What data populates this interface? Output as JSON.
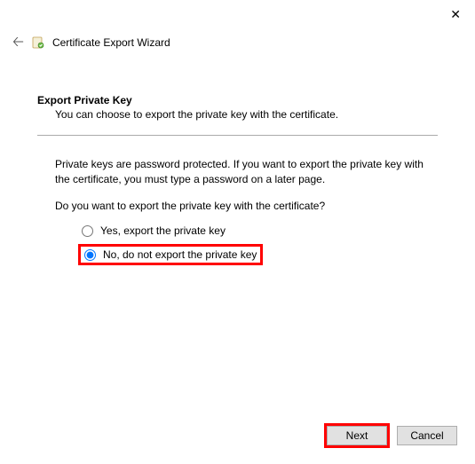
{
  "window": {
    "title": "Certificate Export Wizard"
  },
  "section": {
    "heading": "Export Private Key",
    "subheading": "You can choose to export the private key with the certificate."
  },
  "body": {
    "paragraph1": "Private keys are password protected. If you want to export the private key with the certificate, you must type a password on a later page.",
    "paragraph2": "Do you want to export the private key with the certificate?"
  },
  "radios": {
    "yes": "Yes, export the private key",
    "no": "No, do not export the private key"
  },
  "buttons": {
    "next": "Next",
    "cancel": "Cancel"
  }
}
